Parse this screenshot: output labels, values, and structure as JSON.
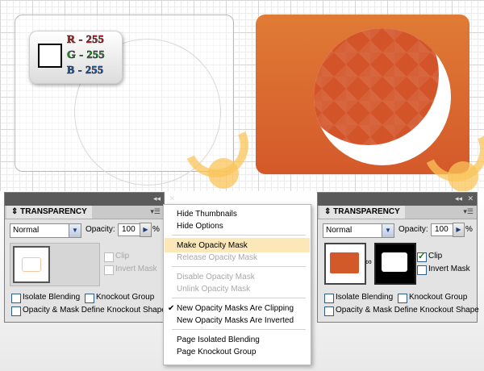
{
  "badge": {
    "r": "R - 255",
    "g": "G - 255",
    "b": "B - 255",
    "r_color": "#e21b1b",
    "g_color": "#21a32b",
    "b_color": "#1e63c8"
  },
  "left_panel": {
    "tab": "TRANSPARENCY",
    "blend_mode": "Normal",
    "opacity_label": "Opacity:",
    "opacity_value": "100",
    "percent": "%",
    "clip": "Clip",
    "invert_mask": "Invert Mask",
    "isolate_blending": "Isolate Blending",
    "knockout_group": "Knockout Group",
    "opacity_mask_knockout": "Opacity & Mask Define Knockout Shape",
    "clip_checked": false,
    "invert_checked": false
  },
  "right_panel": {
    "tab": "TRANSPARENCY",
    "blend_mode": "Normal",
    "opacity_label": "Opacity:",
    "opacity_value": "100",
    "percent": "%",
    "clip": "Clip",
    "invert_mask": "Invert Mask",
    "isolate_blending": "Isolate Blending",
    "knockout_group": "Knockout Group",
    "opacity_mask_knockout": "Opacity & Mask Define Knockout Shape",
    "clip_checked": true,
    "invert_checked": false
  },
  "menu": {
    "hide_thumbnails": "Hide Thumbnails",
    "hide_options": "Hide Options",
    "make_opacity_mask": "Make Opacity Mask",
    "release_opacity_mask": "Release Opacity Mask",
    "disable_opacity_mask": "Disable Opacity Mask",
    "unlink_opacity_mask": "Unlink Opacity Mask",
    "new_masks_clipping": "New Opacity Masks Are Clipping",
    "new_masks_inverted": "New Opacity Masks Are Inverted",
    "page_isolated_blending": "Page Isolated Blending",
    "page_knockout_group": "Page Knockout Group",
    "highlighted_item": "Make Opacity Mask",
    "checked_item": "New Opacity Masks Are Clipping"
  },
  "colors": {
    "accent_orange": "#d9652c",
    "menu_highlight": "#fbe7b8",
    "swoosh": "#f8c35a"
  },
  "icons": [
    "collapse-icon",
    "close-icon",
    "panel-menu-icon",
    "dropdown-arrow-icon",
    "link-icon",
    "checkmark-icon",
    "swoosh-arrow-icon"
  ]
}
